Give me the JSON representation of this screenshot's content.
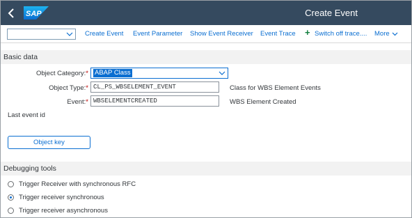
{
  "shell": {
    "back_icon": "back-chevron-icon",
    "logo_text": "SAP",
    "title": "Create Event",
    "brand_color": "#354a5f",
    "logo_color": "#0a6ed1"
  },
  "toolbar": {
    "select_value": "",
    "buttons": [
      "Create Event",
      "Event Parameter",
      "Show Event Receiver",
      "Event Trace",
      "Switch off trace....",
      "More"
    ],
    "switch_icon": "plus-icon",
    "accent_color": "#0a6ed1"
  },
  "basic_data": {
    "header": "Basic data",
    "object_category": {
      "label": "Object Category:",
      "required": "*",
      "value": "ABAP Class"
    },
    "object_type": {
      "label": "Object Type:",
      "required": "*",
      "value": "CL_PS_WBSELEMENT_EVENT",
      "description": "Class for WBS Element Events"
    },
    "event": {
      "label": "Event:",
      "required": "*",
      "value": "WBSELEMENTCREATED",
      "description": "WBS Element Created"
    },
    "last_event_id_label": "Last event id",
    "object_key_button": "Object key"
  },
  "debugging": {
    "header": "Debugging tools",
    "options": [
      {
        "label": "Trigger Receiver with synchronous RFC",
        "selected": false
      },
      {
        "label": "Trigger receiver synchronous",
        "selected": true
      },
      {
        "label": "Trigger receiver asynchronous",
        "selected": false
      }
    ]
  }
}
